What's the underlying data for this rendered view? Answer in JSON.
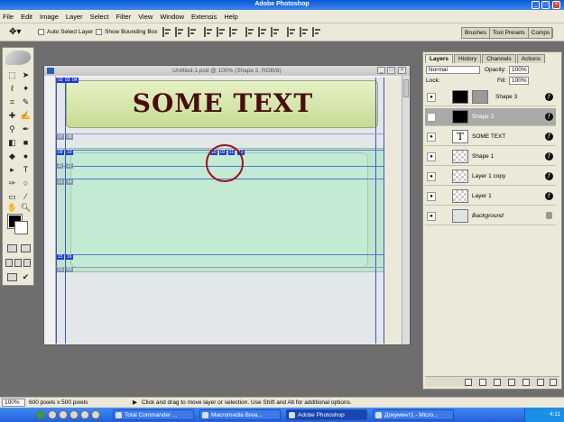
{
  "app": {
    "title": "Adobe Photoshop"
  },
  "menu": [
    "File",
    "Edit",
    "Image",
    "Layer",
    "Select",
    "Filter",
    "View",
    "Window",
    "Extensis",
    "Help"
  ],
  "options": {
    "auto_select": "Auto Select Layer",
    "bounding_box": "Show Bounding Box"
  },
  "palette_well": [
    "Brushes",
    "Tool Presets",
    "Comps"
  ],
  "document": {
    "title": "Untitled-1.psd @ 100% (Shape 2, RGB/8)",
    "banner_text": "SOME TEXT",
    "labels": [
      "02",
      "03",
      "04",
      "07",
      "08",
      "09",
      "10",
      "11",
      "12",
      "13",
      "14",
      "15",
      "16",
      "23",
      "43",
      "10",
      "02"
    ]
  },
  "layers_panel": {
    "tabs": [
      "Layers",
      "History",
      "Channels",
      "Actions"
    ],
    "blend_mode": "Normal",
    "opacity_label": "Opacity:",
    "opacity": "100%",
    "lock_label": "Lock:",
    "fill_label": "Fill:",
    "fill": "100%",
    "layers": [
      {
        "name": "Shape 3",
        "thumb": "black"
      },
      {
        "name": "Shape 2",
        "thumb": "black"
      },
      {
        "name": "SOME TEXT",
        "thumb": "text"
      },
      {
        "name": "Shape 1",
        "thumb": "checker"
      },
      {
        "name": "Layer 1 copy",
        "thumb": "checker"
      },
      {
        "name": "Layer 1",
        "thumb": "checker"
      },
      {
        "name": "Background",
        "thumb": "gray"
      }
    ]
  },
  "status": {
    "zoom": "100%",
    "doc_size": "600 pixels x 500 pixels",
    "hint": "Click and drag to move layer or selection. Use Shift and Alt for additional options."
  },
  "taskbar": {
    "tasks": [
      "Total Commander ...",
      "Macromedia Brea...",
      "Adobe Photoshop",
      "Документ1 - Micro..."
    ],
    "clock": "4:11"
  },
  "colors": {
    "accent": "#0a58d8",
    "banner_text": "#4a0c10",
    "guide": "#3a55c8",
    "band": "#bfe6cd"
  }
}
